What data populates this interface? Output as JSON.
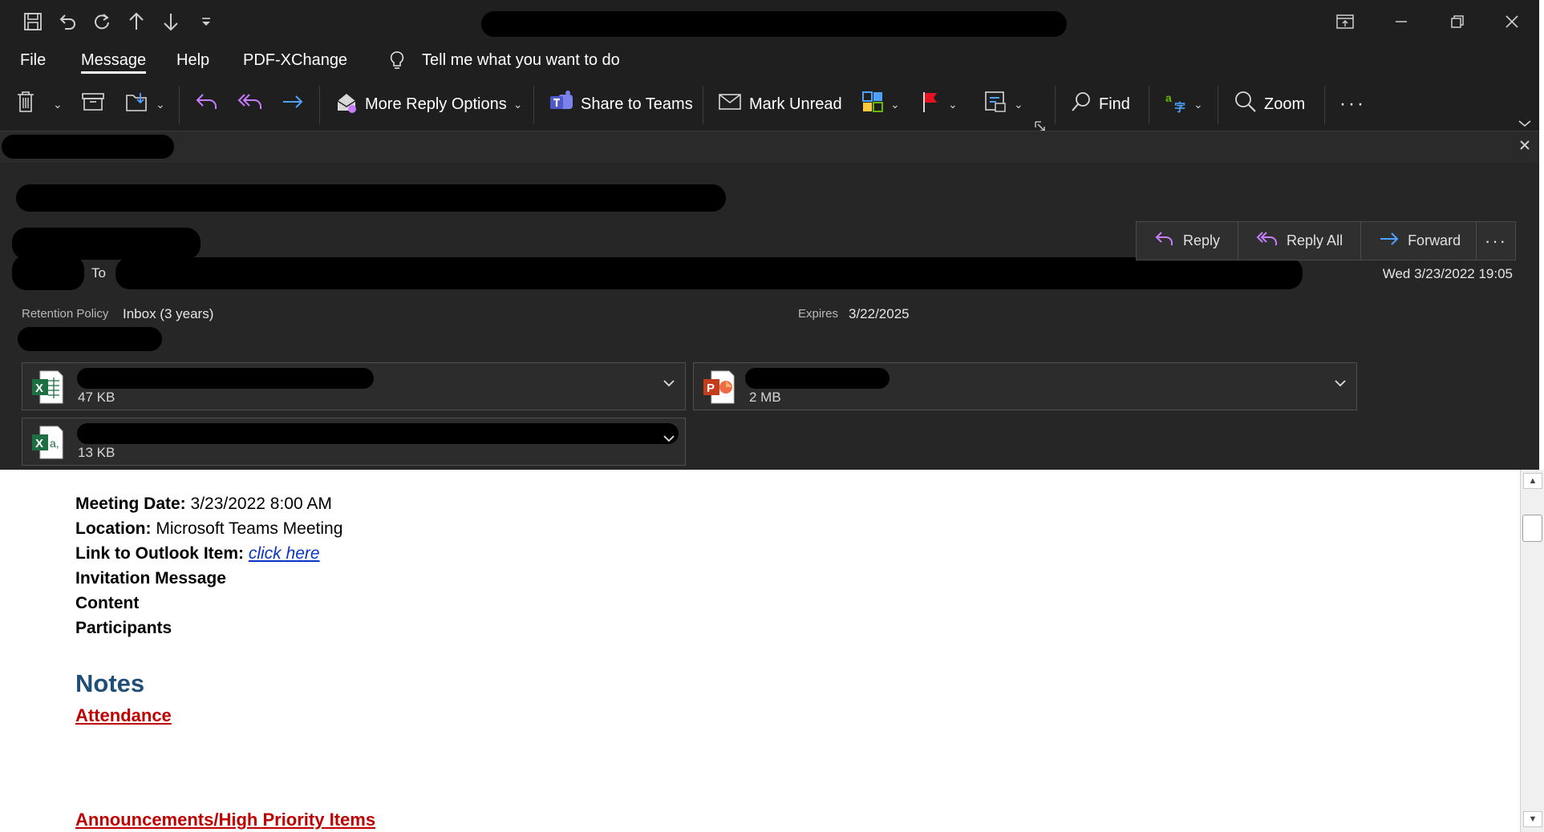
{
  "menu": {
    "file": "File",
    "message": "Message",
    "help": "Help",
    "pdf": "PDF-XChange",
    "tell_me": "Tell me what you want to do"
  },
  "ribbon": {
    "more_reply": "More Reply Options",
    "share_teams": "Share to Teams",
    "mark_unread": "Mark Unread",
    "find": "Find",
    "zoom": "Zoom"
  },
  "header": {
    "to_label": "To",
    "reply": "Reply",
    "reply_all": "Reply All",
    "forward": "Forward",
    "date": "Wed 3/23/2022 19:05",
    "retention_label": "Retention Policy",
    "retention_value": "Inbox (3 years)",
    "expires_label": "Expires",
    "expires_value": "3/22/2025"
  },
  "attachments": [
    {
      "type": "excel",
      "size": "47 KB"
    },
    {
      "type": "powerpoint",
      "size": "2 MB"
    },
    {
      "type": "excel",
      "size": "13 KB"
    }
  ],
  "body": {
    "meeting_date_label": "Meeting Date:",
    "meeting_date_value": "3/23/2022 8:00 AM",
    "location_label": "Location:",
    "location_value": "Microsoft Teams Meeting",
    "link_label": "Link to Outlook Item:",
    "link_text": "click here",
    "invitation": "Invitation Message",
    "content": "Content",
    "participants": "Participants",
    "notes": "Notes",
    "attendance": "Attendance",
    "announcements": "Announcements/High Priority Items"
  },
  "colors": {
    "chrome": "#1f1f1f",
    "header_bg": "#262626",
    "notes_heading": "#1f4e79",
    "red_heading": "#c00000",
    "link": "#0b34c7",
    "excel": "#1d6f42",
    "powerpoint": "#c43e1c",
    "reply_icon": "#c77dff",
    "forward_icon": "#4ea1ff"
  }
}
